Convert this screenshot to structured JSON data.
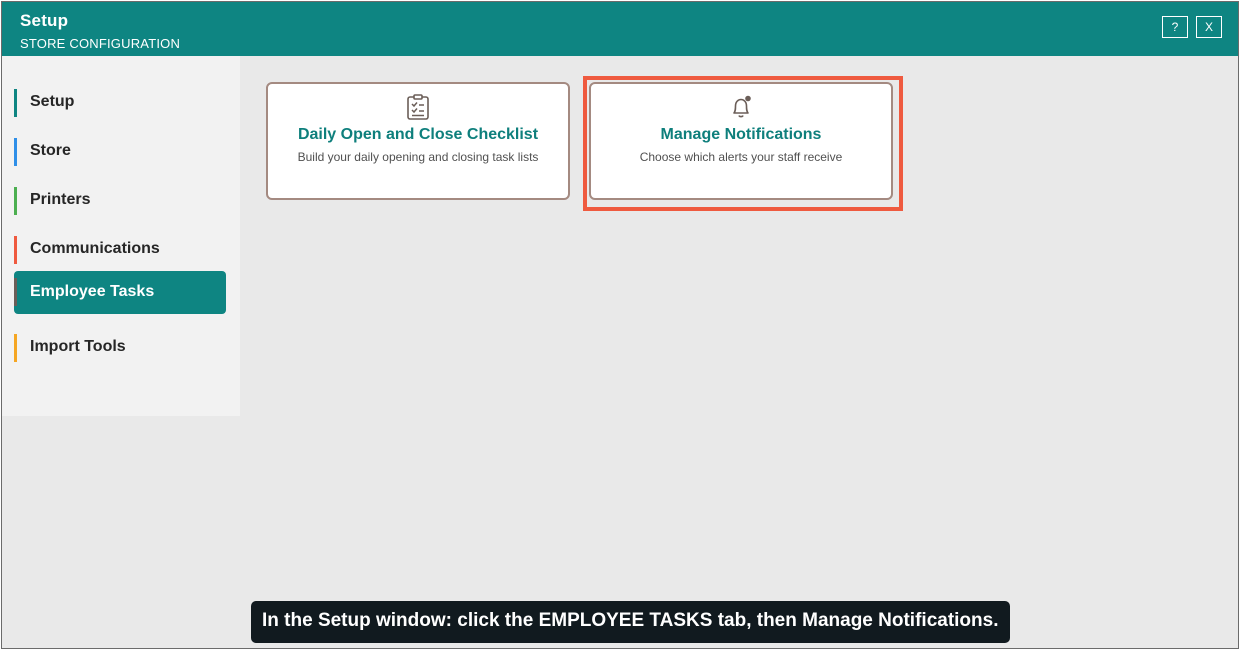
{
  "window": {
    "title": "Setup",
    "subtitle": "STORE CONFIGURATION",
    "help_label": "?",
    "close_label": "X"
  },
  "sidebar": {
    "items": [
      {
        "label": "Setup",
        "accent": "#0e8582",
        "active": false
      },
      {
        "label": "Store",
        "accent": "#2f8fe8",
        "active": false
      },
      {
        "label": "Printers",
        "accent": "#4caf50",
        "active": false
      },
      {
        "label": "Communications",
        "accent": "#ef5a3f",
        "active": false
      },
      {
        "label": "Employee Tasks",
        "accent": "#6b5e58",
        "active": true
      },
      {
        "label": "Import Tools",
        "accent": "#f5a623",
        "active": false
      }
    ]
  },
  "cards": [
    {
      "icon": "clipboard-checklist-icon",
      "title": "Daily Open and Close Checklist",
      "description": "Build your daily opening and closing task lists"
    },
    {
      "icon": "bell-notification-icon",
      "title": "Manage Notifications",
      "description": "Choose which alerts your staff receive",
      "highlighted": true
    }
  ],
  "instruction": "In the Setup window: click the EMPLOYEE TASKS tab, then Manage Notifications.",
  "colors": {
    "titlebar": "#0e8582",
    "card_title": "#0e7f7c",
    "card_border": "#a48a81",
    "highlight": "#ef5a3f"
  }
}
